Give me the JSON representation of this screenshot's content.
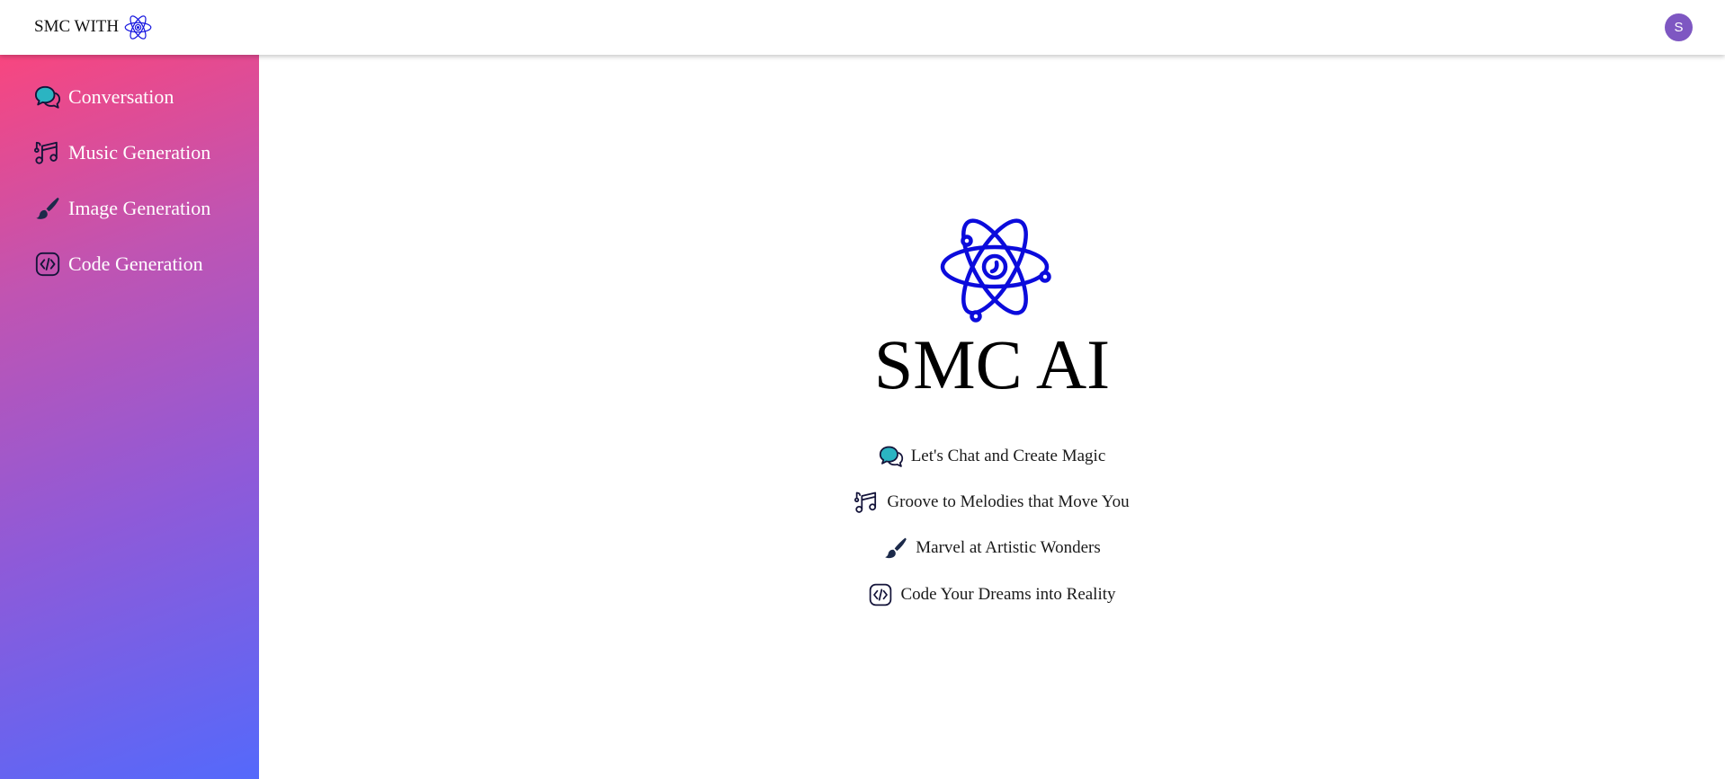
{
  "header": {
    "brand_text": "SMC WITH",
    "brand_icon": "atom-icon",
    "avatar_initial": "S",
    "avatar_color": "#7e57c2",
    "accent_color": "#0b0bdc"
  },
  "sidebar": {
    "gradient": [
      "#f8467f",
      "#c054b2",
      "#8f5ad8",
      "#5469fb"
    ],
    "items": [
      {
        "label": "Conversation",
        "icon": "chat-bubbles-icon"
      },
      {
        "label": "Music Generation",
        "icon": "music-notes-icon"
      },
      {
        "label": "Image Generation",
        "icon": "paintbrush-icon"
      },
      {
        "label": "Code Generation",
        "icon": "code-icon"
      }
    ]
  },
  "hero": {
    "title": "SMC AI",
    "logo_icon": "atom-icon",
    "features": [
      {
        "text": "Let's Chat and Create Magic",
        "icon": "chat-bubbles-icon"
      },
      {
        "text": "Groove to Melodies that Move You",
        "icon": "music-notes-icon"
      },
      {
        "text": "Marvel at Artistic Wonders",
        "icon": "paintbrush-icon"
      },
      {
        "text": "Code Your Dreams into Reality",
        "icon": "code-icon"
      }
    ]
  }
}
